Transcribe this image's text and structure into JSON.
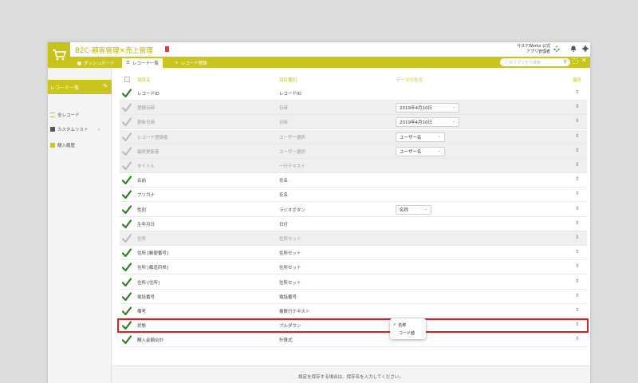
{
  "header": {
    "app_title": "B2C-顧客管理×売上管理",
    "user_line1": "サスケWorks 公式",
    "user_line2": "アプリ管理者"
  },
  "nav": {
    "dashboard": "ダッシュボード",
    "record_list": "レコード一覧",
    "record_register": "レコード登録",
    "search_placeholder": "このアプリから検索"
  },
  "sidebar": {
    "title": "レコード一覧",
    "items": [
      {
        "label": "全レコード"
      },
      {
        "label": "カスタムリスト"
      },
      {
        "label": "購入履歴"
      }
    ]
  },
  "table": {
    "headers": {
      "name": "項目名",
      "type": "項目種別",
      "format": "データの形式",
      "order": "順序"
    },
    "rows": [
      {
        "name": "レコードID",
        "type": "レコードID",
        "enabled": true,
        "select": ""
      },
      {
        "name": "登録日時",
        "type": "日時",
        "enabled": false,
        "select": "2019年4月10日"
      },
      {
        "name": "更新日時",
        "type": "日時",
        "enabled": false,
        "select": "2019年4月10日"
      },
      {
        "name": "レコード登録者",
        "type": "ユーザー選択",
        "enabled": false,
        "select": "ユーザー名"
      },
      {
        "name": "最終更新者",
        "type": "ユーザー選択",
        "enabled": false,
        "select": "ユーザー名"
      },
      {
        "name": "タイトル",
        "type": "一行テキスト",
        "enabled": false,
        "select": ""
      },
      {
        "name": "名前",
        "type": "氏名",
        "enabled": true,
        "select": ""
      },
      {
        "name": "フリガナ",
        "type": "氏名",
        "enabled": true,
        "select": ""
      },
      {
        "name": "性別",
        "type": "ラジオボタン",
        "enabled": true,
        "select": "名称"
      },
      {
        "name": "生年月日",
        "type": "日付",
        "enabled": true,
        "select": ""
      },
      {
        "name": "住所",
        "type": "住所セット",
        "enabled": false,
        "select": ""
      },
      {
        "name": "住所 [郵便番号]",
        "type": "住所セット",
        "enabled": true,
        "select": ""
      },
      {
        "name": "住所 [都道府県]",
        "type": "住所セット",
        "enabled": true,
        "select": ""
      },
      {
        "name": "住所 [住所]",
        "type": "住所セット",
        "enabled": true,
        "select": ""
      },
      {
        "name": "電話番号",
        "type": "電話番号",
        "enabled": true,
        "select": ""
      },
      {
        "name": "備考",
        "type": "複数行テキスト",
        "enabled": true,
        "select": ""
      },
      {
        "name": "状態",
        "type": "プルダウン",
        "enabled": true,
        "select": ""
      },
      {
        "name": "購入金額合計",
        "type": "計算式",
        "enabled": true,
        "select": ""
      }
    ]
  },
  "popup": {
    "options": [
      "名称",
      "コード値"
    ],
    "selected": "名称"
  },
  "footer": {
    "message": "設定を保存する場合は、保存名を入力してください。"
  },
  "colors": {
    "accent": "#c9c51e",
    "check": "#2e7d1f",
    "highlight": "#e02020"
  }
}
